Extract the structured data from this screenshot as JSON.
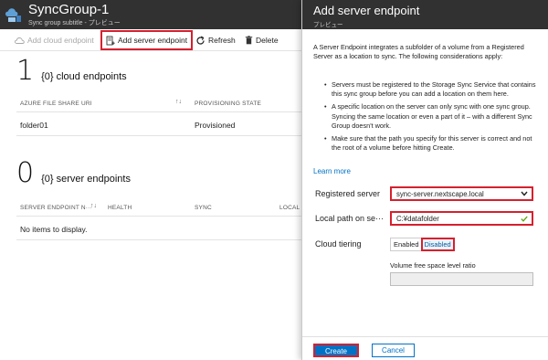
{
  "left_blade": {
    "title": "SyncGroup-1",
    "subtitle": "Sync group subtitle - プレビュー",
    "toolbar": {
      "add_cloud": "Add cloud endpoint",
      "add_server": "Add server endpoint",
      "refresh": "Refresh",
      "delete": "Delete"
    },
    "cloud_section": {
      "count": "1",
      "label": "{0} cloud endpoints",
      "columns": [
        "AZURE FILE SHARE URI",
        "PROVISIONING STATE"
      ],
      "rows": [
        {
          "uri": "folder01",
          "state": "Provisioned"
        }
      ]
    },
    "server_section": {
      "count": "0",
      "label": "{0} server endpoints",
      "columns": [
        "SERVER ENDPOINT N···",
        "HEALTH",
        "SYNC",
        "LOCAL"
      ],
      "empty_text": "No items to display."
    }
  },
  "right_blade": {
    "title": "Add server endpoint",
    "subtitle": "プレビュー",
    "intro": "A Server Endpoint integrates a subfolder of a volume from a Registered Server as a location to sync. The following considerations apply:",
    "bullets": [
      "Servers must be registered to the Storage Sync Service that contains this sync group before you can add a location on them here.",
      "A specific location on the server can only sync with one sync group. Syncing the same location or even a part of it – with a different Sync Group doesn't work.",
      "Make sure that the path you specify for this server is correct and not the root of a volume before hitting Create."
    ],
    "learn_more": "Learn more",
    "fields": {
      "registered_server_label": "Registered server",
      "registered_server_value": "sync-server.nextscape.local",
      "local_path_label": "Local path on se···",
      "local_path_value": "C:¥datafolder",
      "cloud_tiering_label": "Cloud tiering",
      "tiering_enabled": "Enabled",
      "tiering_disabled": "Disabled",
      "tiering_selected": "Disabled",
      "volume_label": "Volume free space level ratio",
      "volume_value": ""
    },
    "buttons": {
      "create": "Create",
      "cancel": "Cancel"
    }
  },
  "colors": {
    "header_bg": "#313131",
    "accent": "#0072c6",
    "highlight": "#d6202e",
    "check": "#57a300"
  },
  "icons": [
    "sync-group-icon",
    "add-cloud-icon",
    "add-server-icon",
    "refresh-icon",
    "delete-icon",
    "sort-icon",
    "chevron-down-icon",
    "checkmark-icon"
  ]
}
